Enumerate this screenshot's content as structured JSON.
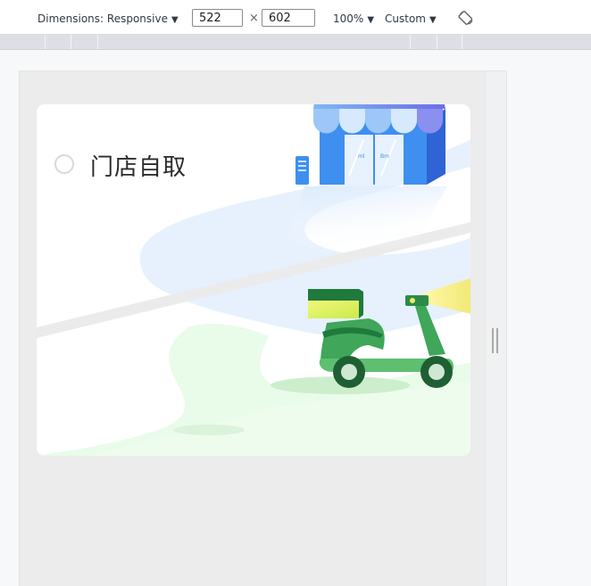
{
  "toolbar": {
    "dimensions_label": "Dimensions: Responsive",
    "width_value": "522",
    "height_value": "602",
    "times_symbol": "×",
    "zoom_label": "100%",
    "throttle_label": "Custom",
    "caret": "▼",
    "rotate_icon": "rotate-icon"
  },
  "card": {
    "option_label": "门店自取",
    "radio_checked": false,
    "store_door_sign_left": "ml",
    "store_door_sign_right": "Bm"
  },
  "colors": {
    "store_blue": "#3e8ff0",
    "awning_purple": "#6f6ee8",
    "scooter_green": "#3fa65a",
    "box_yellow": "#e6f25c",
    "road_green": "#e9fbe9",
    "road_blue": "#e6f1fd"
  }
}
